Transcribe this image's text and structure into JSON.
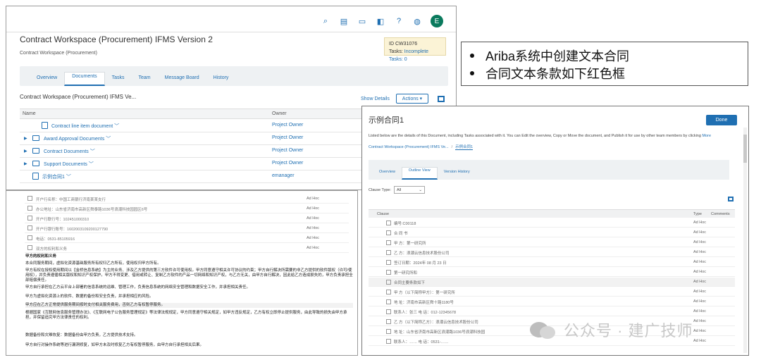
{
  "top_panel": {
    "icons": [
      "search-icon",
      "print-icon",
      "chat-icon",
      "messages-icon",
      "help-icon",
      "announcement-icon"
    ],
    "avatar_initial": "E",
    "title": "Contract Workspace (Procurement) IFMS Version 2",
    "subtitle": "Contract Workspace (Procurement)",
    "id_label": "ID",
    "id_value": "CW31076",
    "tasks_label": "Tasks:",
    "tasks_value": "Incomplete Tasks: 0",
    "tabs": [
      "Overview",
      "Documents",
      "Tasks",
      "Team",
      "Message Board",
      "History"
    ],
    "active_tab": "Documents",
    "section_title": "Contract Workspace (Procurement) IFMS Ve...",
    "show_details": "Show Details",
    "actions": "Actions ▾",
    "columns": {
      "name": "Name",
      "owner": "Owner"
    },
    "rows": [
      {
        "name": "Contract line item document ﹀",
        "owner": "Project Owner"
      },
      {
        "name": "Award Approval Documents ﹀",
        "owner": "Project Owner"
      },
      {
        "name": "Contract Documents ﹀",
        "owner": "Project Owner"
      },
      {
        "name": "Support Documents ﹀",
        "owner": "Project Owner"
      },
      {
        "name": "示例合同1 ﹀",
        "owner": "emanager"
      }
    ]
  },
  "bottom_panel": {
    "rows": [
      {
        "text": "开户行名称：中国工商银行济南某某支行",
        "type": "Ad Hoc"
      },
      {
        "text": "办公地址：山东省济南市高新区舜泰路1036号浪潮科技园园区6号",
        "type": "Ad Hoc"
      },
      {
        "text": "开户行联行号：102451000310",
        "type": "Ad Hoc"
      },
      {
        "text": "开户行银行账号：1602003109200127790",
        "type": "Ad Hoc"
      },
      {
        "text": "电话：0531-85105916",
        "type": "Ad Hoc"
      },
      {
        "text": "双方的权利和义务",
        "type": "Ad Hoc"
      }
    ],
    "paragraphs": [
      "甲方的权利和义务",
      "本合同服务期间，虚拟化资源基础服务所有权归乙方所有，使用权归甲方所有。",
      "甲方有权在授权使用期间以【金桥信息系统】为主的业务、涉及乙方提供的第三方软件许可使用权。甲方同意遵守相关许可协议的约束；甲方自行解决所需要的非乙方提供的软件版权（许可/使用权），并负责遵循相关版权和知识产权保护。甲方不得变更、借用或转让、复制乙方软件的产品一切网络和知识产权，与乙方无关，由甲方自行解决，因此给乙方造成损失的，甲方负责承担全部赔偿责任。",
      "甲方自行承担在乙方云平台上部署的信息系统的运维、管理工作，负责信息系统的网络安全管理和数据安全工作，并承担相关责任。",
      "甲方为虚拟化资源上的软件、数据的备份和安全负责，并承担相应的风险。",
      "甲方应在乙方正常提供服务期间按时支付相关服务费用，否则乙方有权暂停服务。",
      "根据国家《互联网信息服务管理办法》、《互联网电子公告服务管理规定》等法律法规规定，甲方同意遵守相关规定，如甲方违反规定，乙方有权立即停止提供服务，由此导致的损失由甲方承担，并保留追究甲方法律责任的权利。",
      "数据备份和灾难恢复：数据备份由甲方负责，乙方提供技术支持。",
      "甲方自行对操作系统等进行漏洞修复，如甲方未及时修复乙方有权暂停服务，由甲方自行承担相关后果。"
    ]
  },
  "bullets": [
    "Ariba系统中创建文本合同",
    "合同文本条款如下红色框"
  ],
  "right_panel": {
    "title": "示例合同1",
    "done": "Done",
    "description": "Listed below are the details of this Document, including Tasks associated with it. You can Edit the overview, Copy or Move the document, and Publish it for use by other team members by clicking",
    "more": "More",
    "breadcrumb_parent": "Contract Workspace (Procurement) IFMS Ve...",
    "breadcrumb_current": "示例合同1",
    "tabs": [
      "Overview",
      "Outline View",
      "Version History"
    ],
    "active_tab": "Outline View",
    "clause_type_label": "Clause Type:",
    "clause_type_value": "All",
    "columns": {
      "clause": "Clause",
      "type": "Type",
      "comments": "Comments"
    },
    "rows": [
      {
        "text": "编号:C00118",
        "type": "Ad Hoc"
      },
      {
        "text": "合 同 书",
        "type": "Ad Hoc"
      },
      {
        "text": "甲 方：第一研究所",
        "type": "Ad Hoc"
      },
      {
        "text": "乙 方：浪潮云信息技术股份公司",
        "type": "Ad Hoc"
      },
      {
        "text": "签订日期：2024年 08 月 23 日",
        "type": "Ad Hoc"
      },
      {
        "text": "第一研究所和",
        "type": "Ad Hoc"
      },
      {
        "text": "合同主要条款如下",
        "type": "Ad Hoc"
      },
      {
        "text": "甲 方（以下简称甲方）：第一研究所",
        "type": "Ad Hoc"
      },
      {
        "text": "地 址：济南市高新区舜十路1180号",
        "type": "Ad Hoc"
      },
      {
        "text": "联系人：张三 电 话：012-12345678",
        "type": "Ad Hoc"
      },
      {
        "text": "乙 方（以下简称乙方）：浪潮云信息技术股份公司",
        "type": "Ad Hoc"
      },
      {
        "text": "地 址：山东省济南市高新区浪潮路1036号浪潮科技园",
        "type": "Ad Hoc"
      },
      {
        "text": "联系人：…… 电 话：0531-……",
        "type": "Ad Hoc"
      }
    ]
  },
  "watermark": "公众号 · 建广技师"
}
